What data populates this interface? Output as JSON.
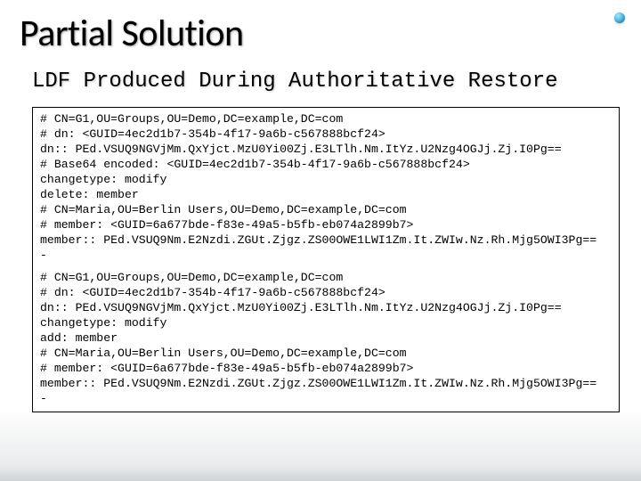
{
  "title": "Partial Solution",
  "subtitle": "LDF Produced During Authoritative Restore",
  "code_block1": [
    "# CN=G1,OU=Groups,OU=Demo,DC=example,DC=com",
    "# dn: <GUID=4ec2d1b7-354b-4f17-9a6b-c567888bcf24>",
    "dn:: PEd.VSUQ9NGVjMm.QxYjct.MzU0Yi00Zj.E3LTlh.Nm.ItYz.U2Nzg4OGJj.Zj.I0Pg==",
    "# Base64 encoded: <GUID=4ec2d1b7-354b-4f17-9a6b-c567888bcf24>",
    "changetype: modify",
    "delete: member",
    "# CN=Maria,OU=Berlin Users,OU=Demo,DC=example,DC=com",
    "# member: <GUID=6a677bde-f83e-49a5-b5fb-eb074a2899b7>",
    "member:: PEd.VSUQ9Nm.E2Nzdi.ZGUt.Zjgz.ZS00OWE1LWI1Zm.It.ZWIw.Nz.Rh.Mjg5OWI3Pg==",
    "-"
  ],
  "code_block2": [
    "# CN=G1,OU=Groups,OU=Demo,DC=example,DC=com",
    "# dn: <GUID=4ec2d1b7-354b-4f17-9a6b-c567888bcf24>",
    "dn:: PEd.VSUQ9NGVjMm.QxYjct.MzU0Yi00Zj.E3LTlh.Nm.ItYz.U2Nzg4OGJj.Zj.I0Pg==",
    "changetype: modify",
    "add: member",
    "# CN=Maria,OU=Berlin Users,OU=Demo,DC=example,DC=com",
    "# member: <GUID=6a677bde-f83e-49a5-b5fb-eb074a2899b7>",
    "member:: PEd.VSUQ9Nm.E2Nzdi.ZGUt.Zjgz.ZS00OWE1LWI1Zm.It.ZWIw.Nz.Rh.Mjg5OWI3Pg==",
    "-"
  ]
}
